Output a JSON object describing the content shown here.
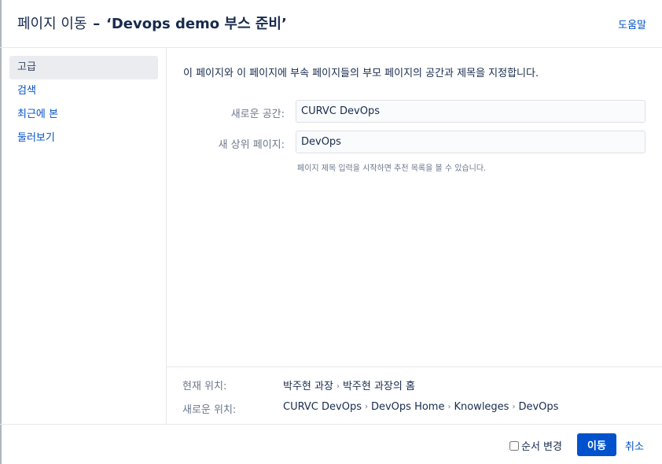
{
  "header": {
    "title_prefix": "페이지 이동",
    "title_dash": "–",
    "title_page": "‘Devops demo 부스 준비’",
    "help_label": "도움말"
  },
  "sidebar": {
    "items": [
      {
        "label": "고급",
        "active": true
      },
      {
        "label": "검색",
        "active": false
      },
      {
        "label": "최근에 본",
        "active": false
      },
      {
        "label": "둘러보기",
        "active": false
      }
    ]
  },
  "main": {
    "description": "이 페이지와 이 페이지에 부속 페이지들의 부모 페이지의 공간과 제목을 지정합니다.",
    "new_space_label": "새로운 공간:",
    "new_space_value": "CURVC DevOps",
    "new_parent_label": "새 상위 페이지:",
    "new_parent_value": "DevOps",
    "hint": "페이지 제목 입력을 시작하면 추천 목록을 볼 수 있습니다."
  },
  "location": {
    "current_label": "현재 위치:",
    "current_path": [
      "박주현 과장",
      "박주현 과장의 홈"
    ],
    "new_label": "새로운 위치:",
    "new_path": [
      "CURVC DevOps",
      "DevOps Home",
      "Knowleges",
      "DevOps"
    ],
    "separator": "›"
  },
  "footer": {
    "reorder_label": "순서 변경",
    "reorder_checked": false,
    "move_label": "이동",
    "cancel_label": "취소"
  },
  "colors": {
    "primary": "#0052cc",
    "active_bg": "#ebecf0",
    "text": "#172b4d",
    "subtle": "#6b778c"
  }
}
